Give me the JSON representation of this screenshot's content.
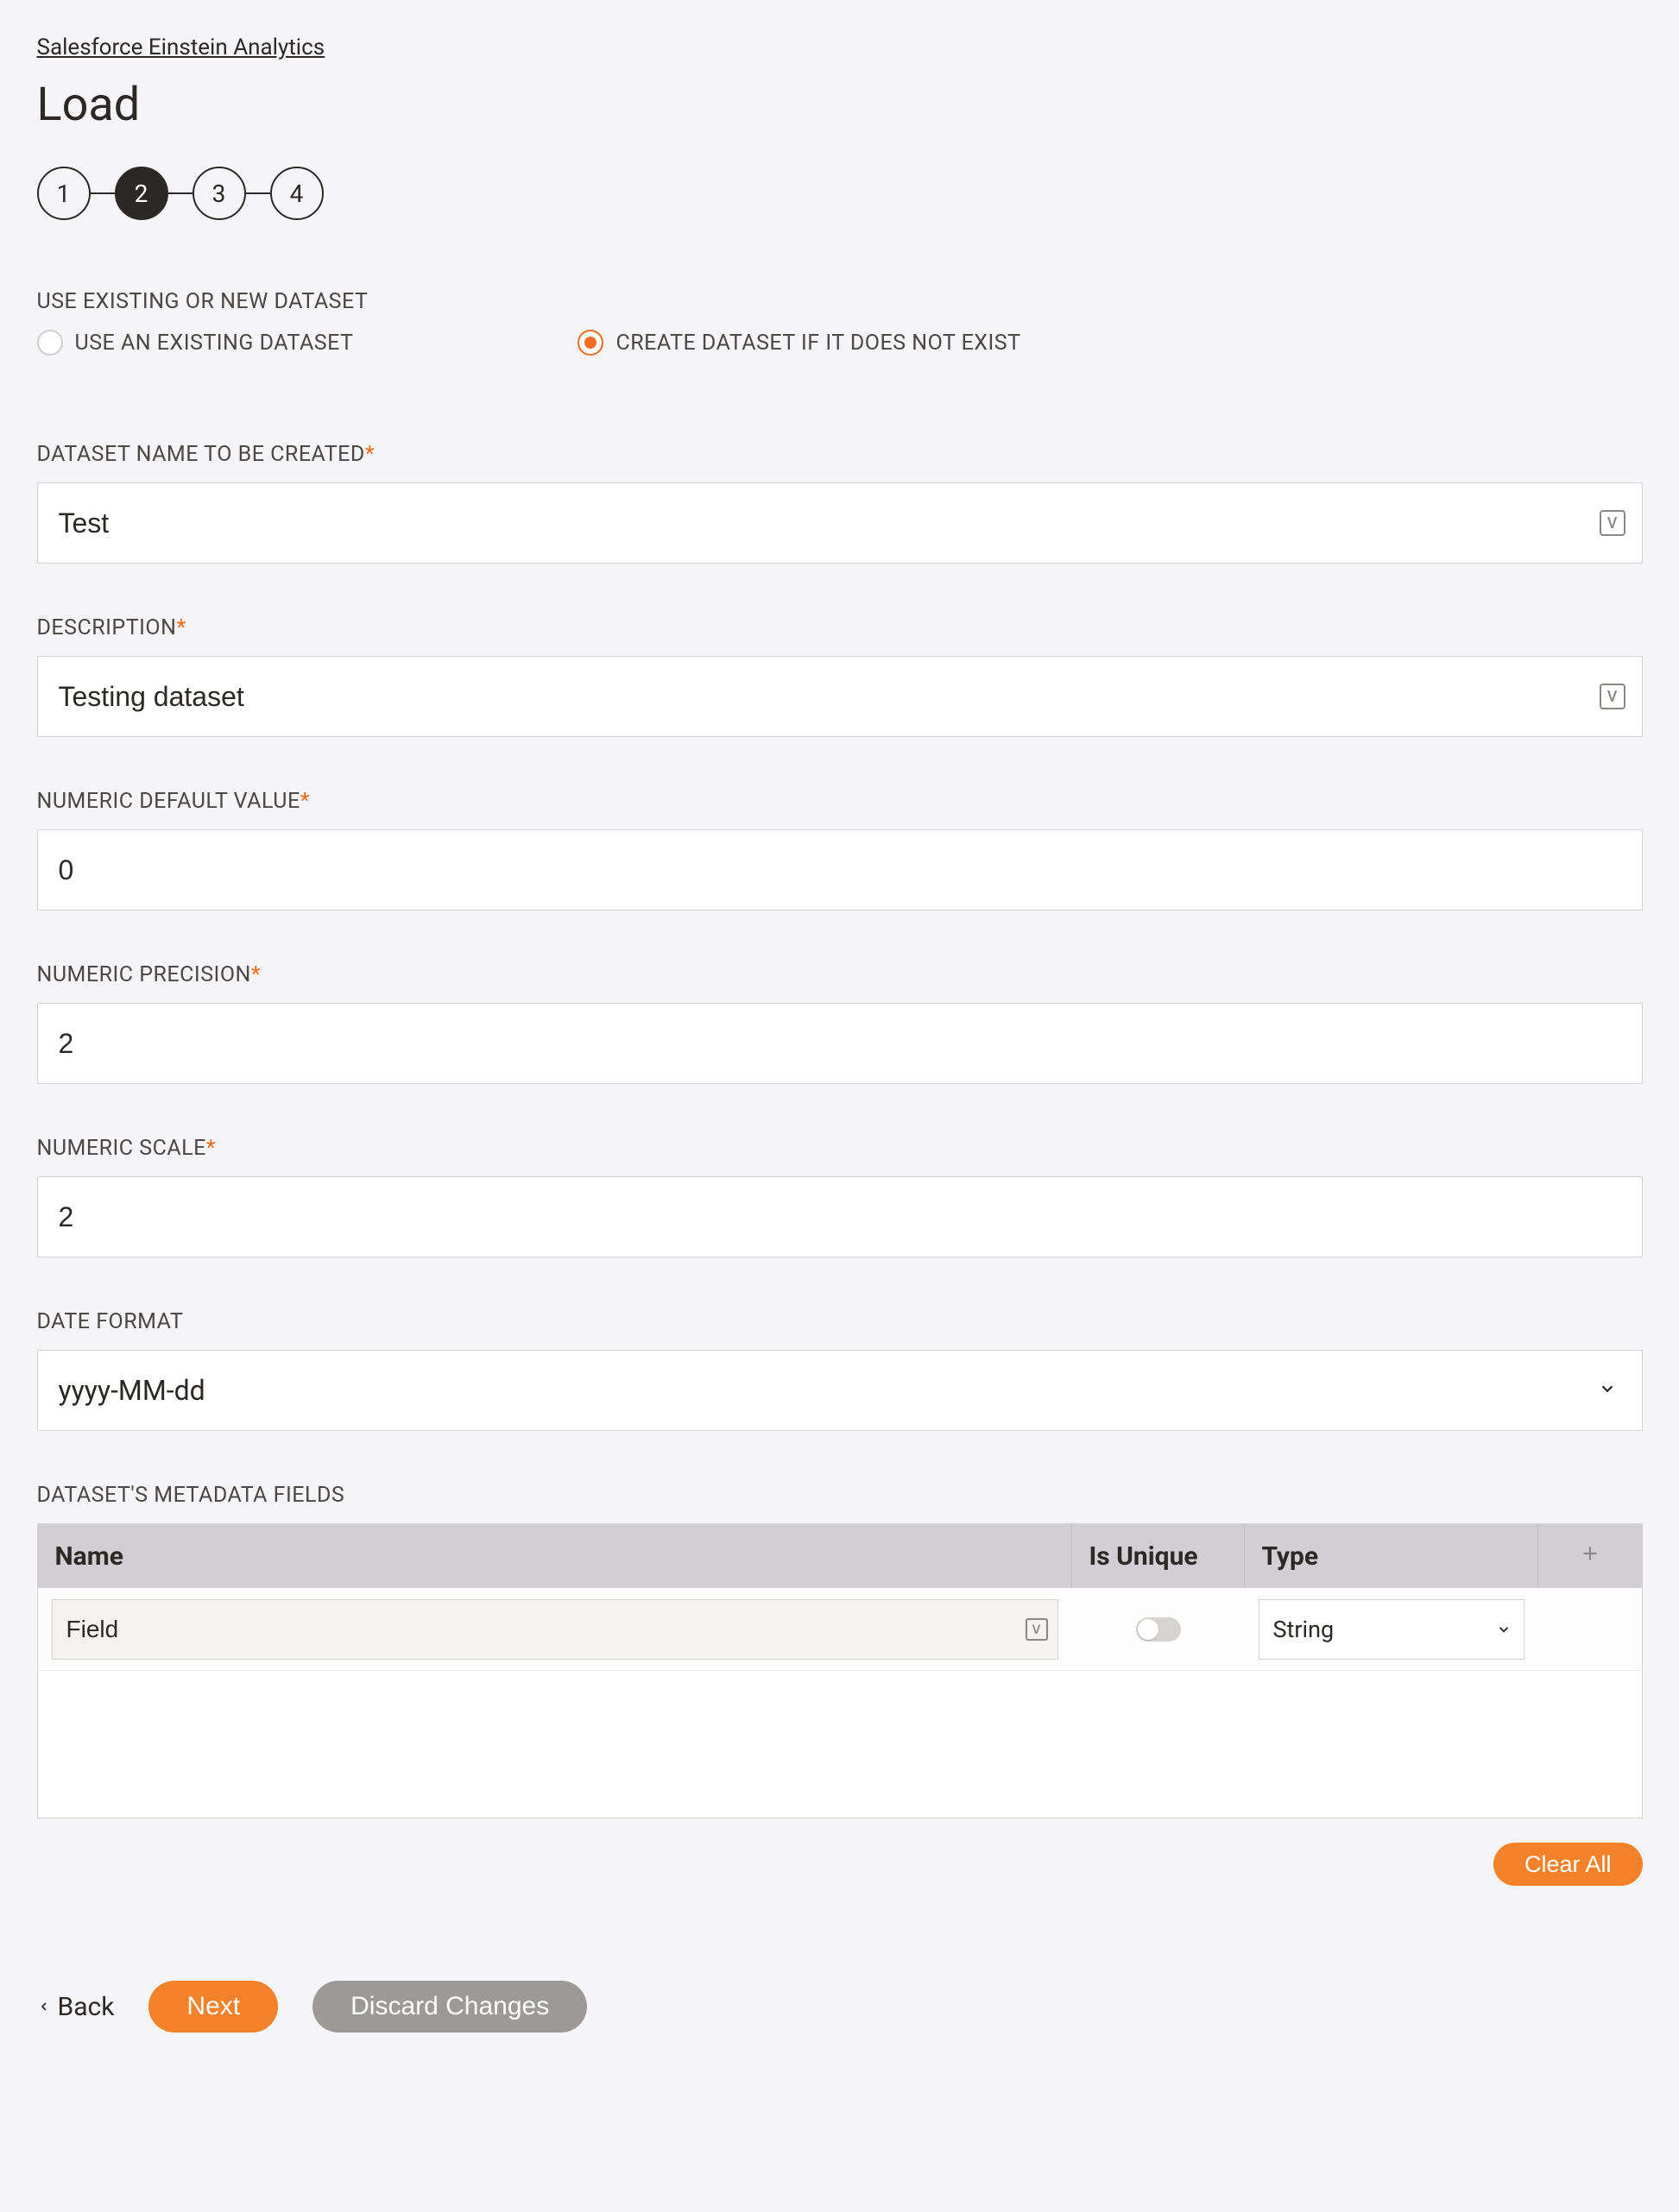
{
  "breadcrumb": "Salesforce Einstein Analytics",
  "title": "Load",
  "steps": [
    "1",
    "2",
    "3",
    "4"
  ],
  "activeStep": 1,
  "section_dataset_mode": {
    "label": "USE EXISTING OR NEW DATASET",
    "options": {
      "existing": "USE AN EXISTING DATASET",
      "create": "CREATE DATASET IF IT DOES NOT EXIST"
    },
    "selected": "create"
  },
  "fields": {
    "datasetName": {
      "label": "DATASET NAME TO BE CREATED",
      "required": true,
      "value": "Test"
    },
    "description": {
      "label": "DESCRIPTION",
      "required": true,
      "value": "Testing dataset"
    },
    "numericDefault": {
      "label": "NUMERIC DEFAULT VALUE",
      "required": true,
      "value": "0"
    },
    "numericPrecision": {
      "label": "NUMERIC PRECISION",
      "required": true,
      "value": "2"
    },
    "numericScale": {
      "label": "NUMERIC SCALE",
      "required": true,
      "value": "2"
    },
    "dateFormat": {
      "label": "DATE FORMAT",
      "required": false,
      "value": "yyyy-MM-dd"
    }
  },
  "metadata": {
    "label": "DATASET'S METADATA FIELDS",
    "columns": {
      "name": "Name",
      "isUnique": "Is Unique",
      "type": "Type"
    },
    "rows": [
      {
        "name": "Field",
        "isUnique": false,
        "type": "String"
      }
    ]
  },
  "buttons": {
    "clearAll": "Clear All",
    "back": "Back",
    "next": "Next",
    "discard": "Discard Changes"
  }
}
